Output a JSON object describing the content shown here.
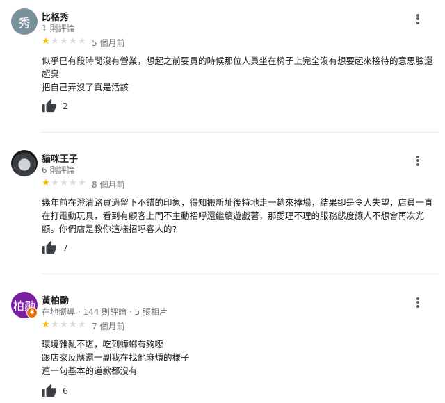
{
  "reviews": [
    {
      "avatar_text": "秀",
      "name": "比格秀",
      "meta": "1 則評論",
      "rating": 1,
      "time": "5 個月前",
      "lines": [
        "似乎已有段時間沒有營業，想起之前要買的時候那位人員坐在椅子上完全沒有想要起來接待的意思臉還超臭",
        "把自己弄沒了真是活該"
      ],
      "likes": "2"
    },
    {
      "avatar_text": "",
      "name": "貓咪王子",
      "meta": "6 則評論",
      "rating": 1,
      "time": "8 個月前",
      "lines": [
        "幾年前在澄清路買過留下不錯的印象，得知搬新址後特地走一趟來捧場，結果卻是令人失望，店員一直在打電動玩具，看到有顧客上門不主動招呼還繼續遊戲著，那愛理不理的服務態度讓人不想會再次光顧。你們店是教你這樣招呼客人的?"
      ],
      "likes": "7"
    },
    {
      "avatar_text": "柏勛",
      "name": "黃柏勛",
      "meta": "在地嚮導 · 144 則評論 · 5 張相片",
      "rating": 1,
      "time": "7 個月前",
      "lines": [
        "環境雜亂不堪，吃到蟑螂有夠噁",
        "跟店家反應還一副我在找他麻煩的樣子",
        "連一句基本的道歉都沒有"
      ],
      "likes": "6"
    }
  ],
  "icons": {
    "like": "thumbs-up-icon",
    "more": "more-vert-icon",
    "local_guide": "local-guide-badge-icon"
  },
  "colors": {
    "star_filled": "#fbbc04",
    "star_empty": "#dadce0",
    "avatar_gray": "#78909c",
    "avatar_purple": "#7b1fa2",
    "local_guide_badge": "#e8710a"
  }
}
